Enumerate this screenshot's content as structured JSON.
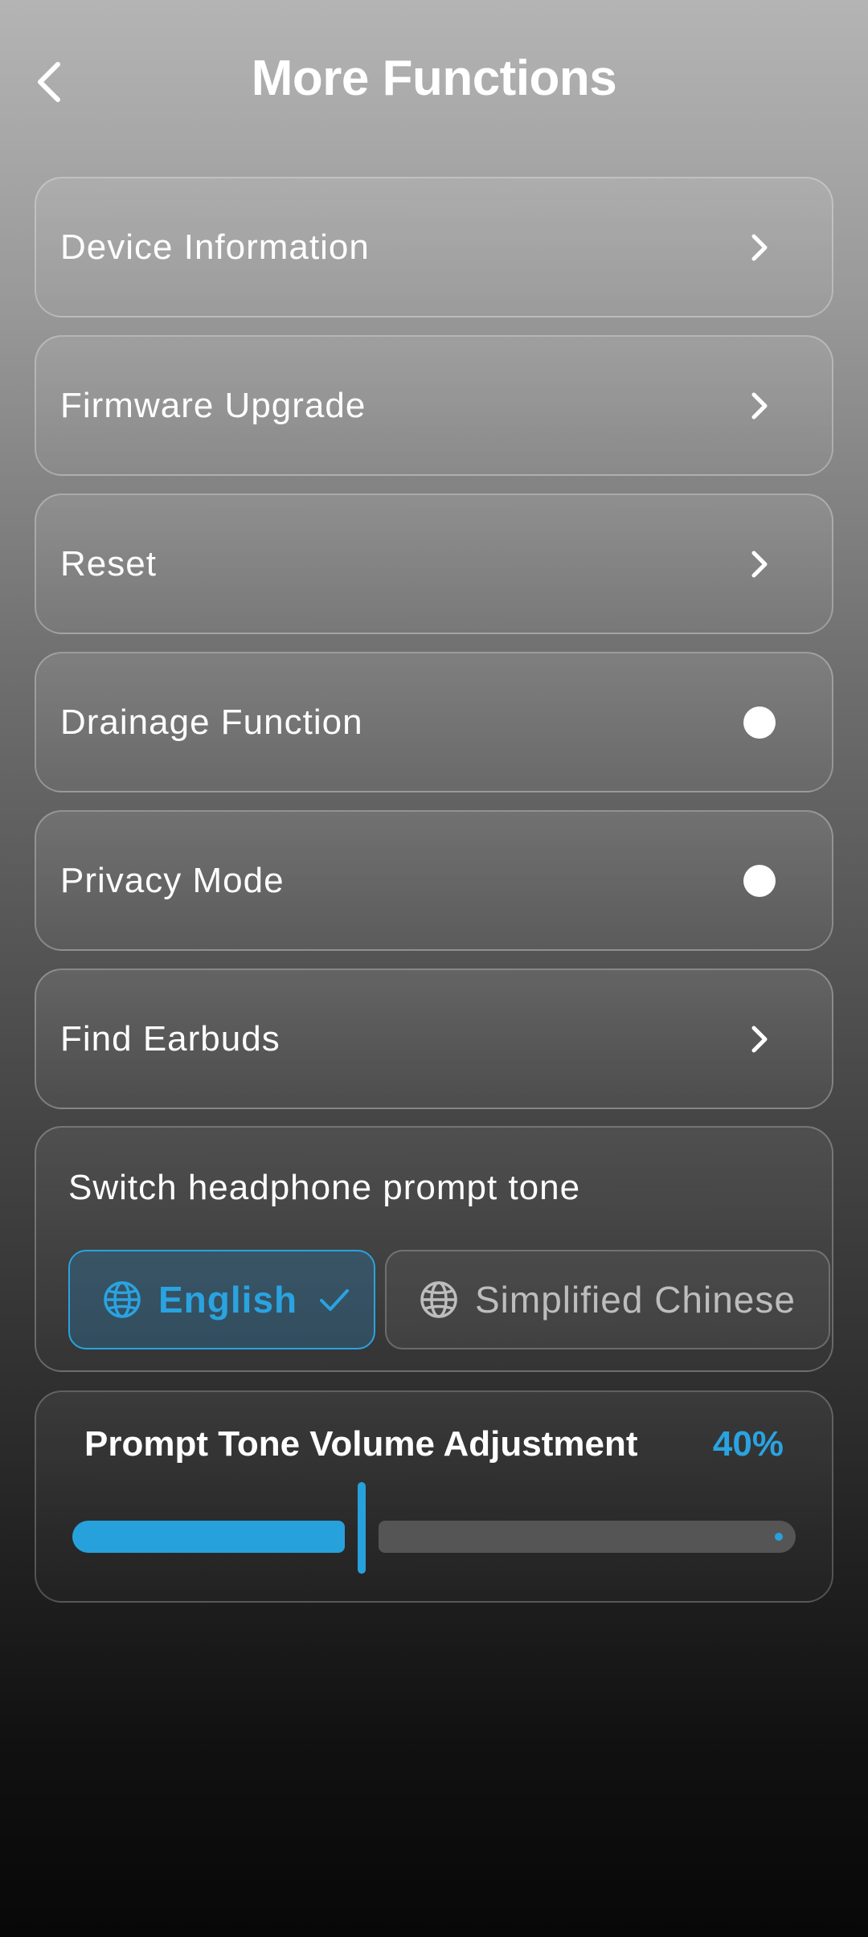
{
  "header": {
    "title": "More Functions"
  },
  "items": [
    {
      "label": "Device Information",
      "control": "chevron"
    },
    {
      "label": "Firmware Upgrade",
      "control": "chevron"
    },
    {
      "label": "Reset",
      "control": "chevron"
    },
    {
      "label": "Drainage Function",
      "control": "toggle",
      "on": false
    },
    {
      "label": "Privacy Mode",
      "control": "toggle",
      "on": false
    },
    {
      "label": "Find Earbuds",
      "control": "chevron"
    }
  ],
  "prompt_tone": {
    "title": "Switch headphone prompt tone",
    "options": [
      {
        "label": "English",
        "selected": true
      },
      {
        "label": "Simplified Chinese",
        "selected": false
      }
    ]
  },
  "volume": {
    "title": "Prompt Tone Volume Adjustment",
    "value_label": "40%",
    "level": 0.4
  },
  "colors": {
    "accent": "#2aa3e0"
  }
}
